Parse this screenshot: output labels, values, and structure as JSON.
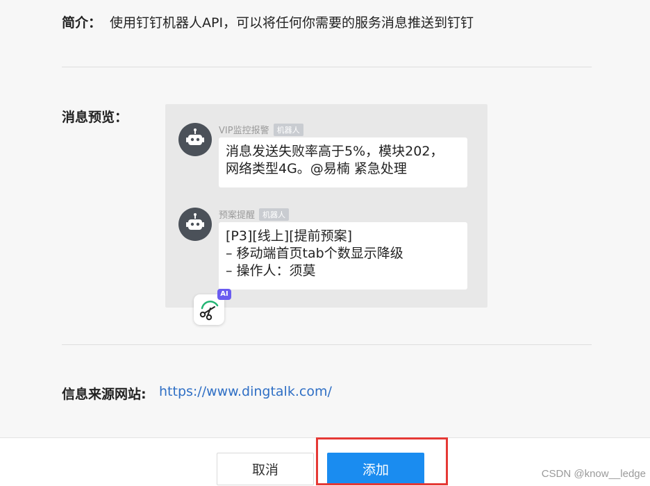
{
  "intro": {
    "label": "简介：",
    "text": "使用钉钉机器人API，可以将任何你需要的服务消息推送到钉钉"
  },
  "preview": {
    "label": "消息预览：",
    "messages": [
      {
        "sender": "VIP监控报警",
        "tag": "机器人",
        "lines": [
          "消息发送失败率高于5%，模块202，",
          "网络类型4G。@易楠 紧急处理"
        ]
      },
      {
        "sender": "预案提醒",
        "tag": "机器人",
        "lines": [
          "[P3][线上][提前预案]",
          "– 移动端首页tab个数显示降级",
          "– 操作人：须莫"
        ]
      }
    ],
    "ai_badge": "AI",
    "ai_icon": "scissors-icon"
  },
  "source": {
    "label": "信息来源网站:",
    "url": "https://www.dingtalk.com/"
  },
  "footer": {
    "cancel_label": "取消",
    "add_label": "添加"
  },
  "watermark": "CSDN @know__ledge",
  "colors": {
    "primary": "#1a8cf0",
    "link": "#2f6fc5",
    "highlight": "#e53935",
    "ai_badge": "#6a5cf0"
  }
}
